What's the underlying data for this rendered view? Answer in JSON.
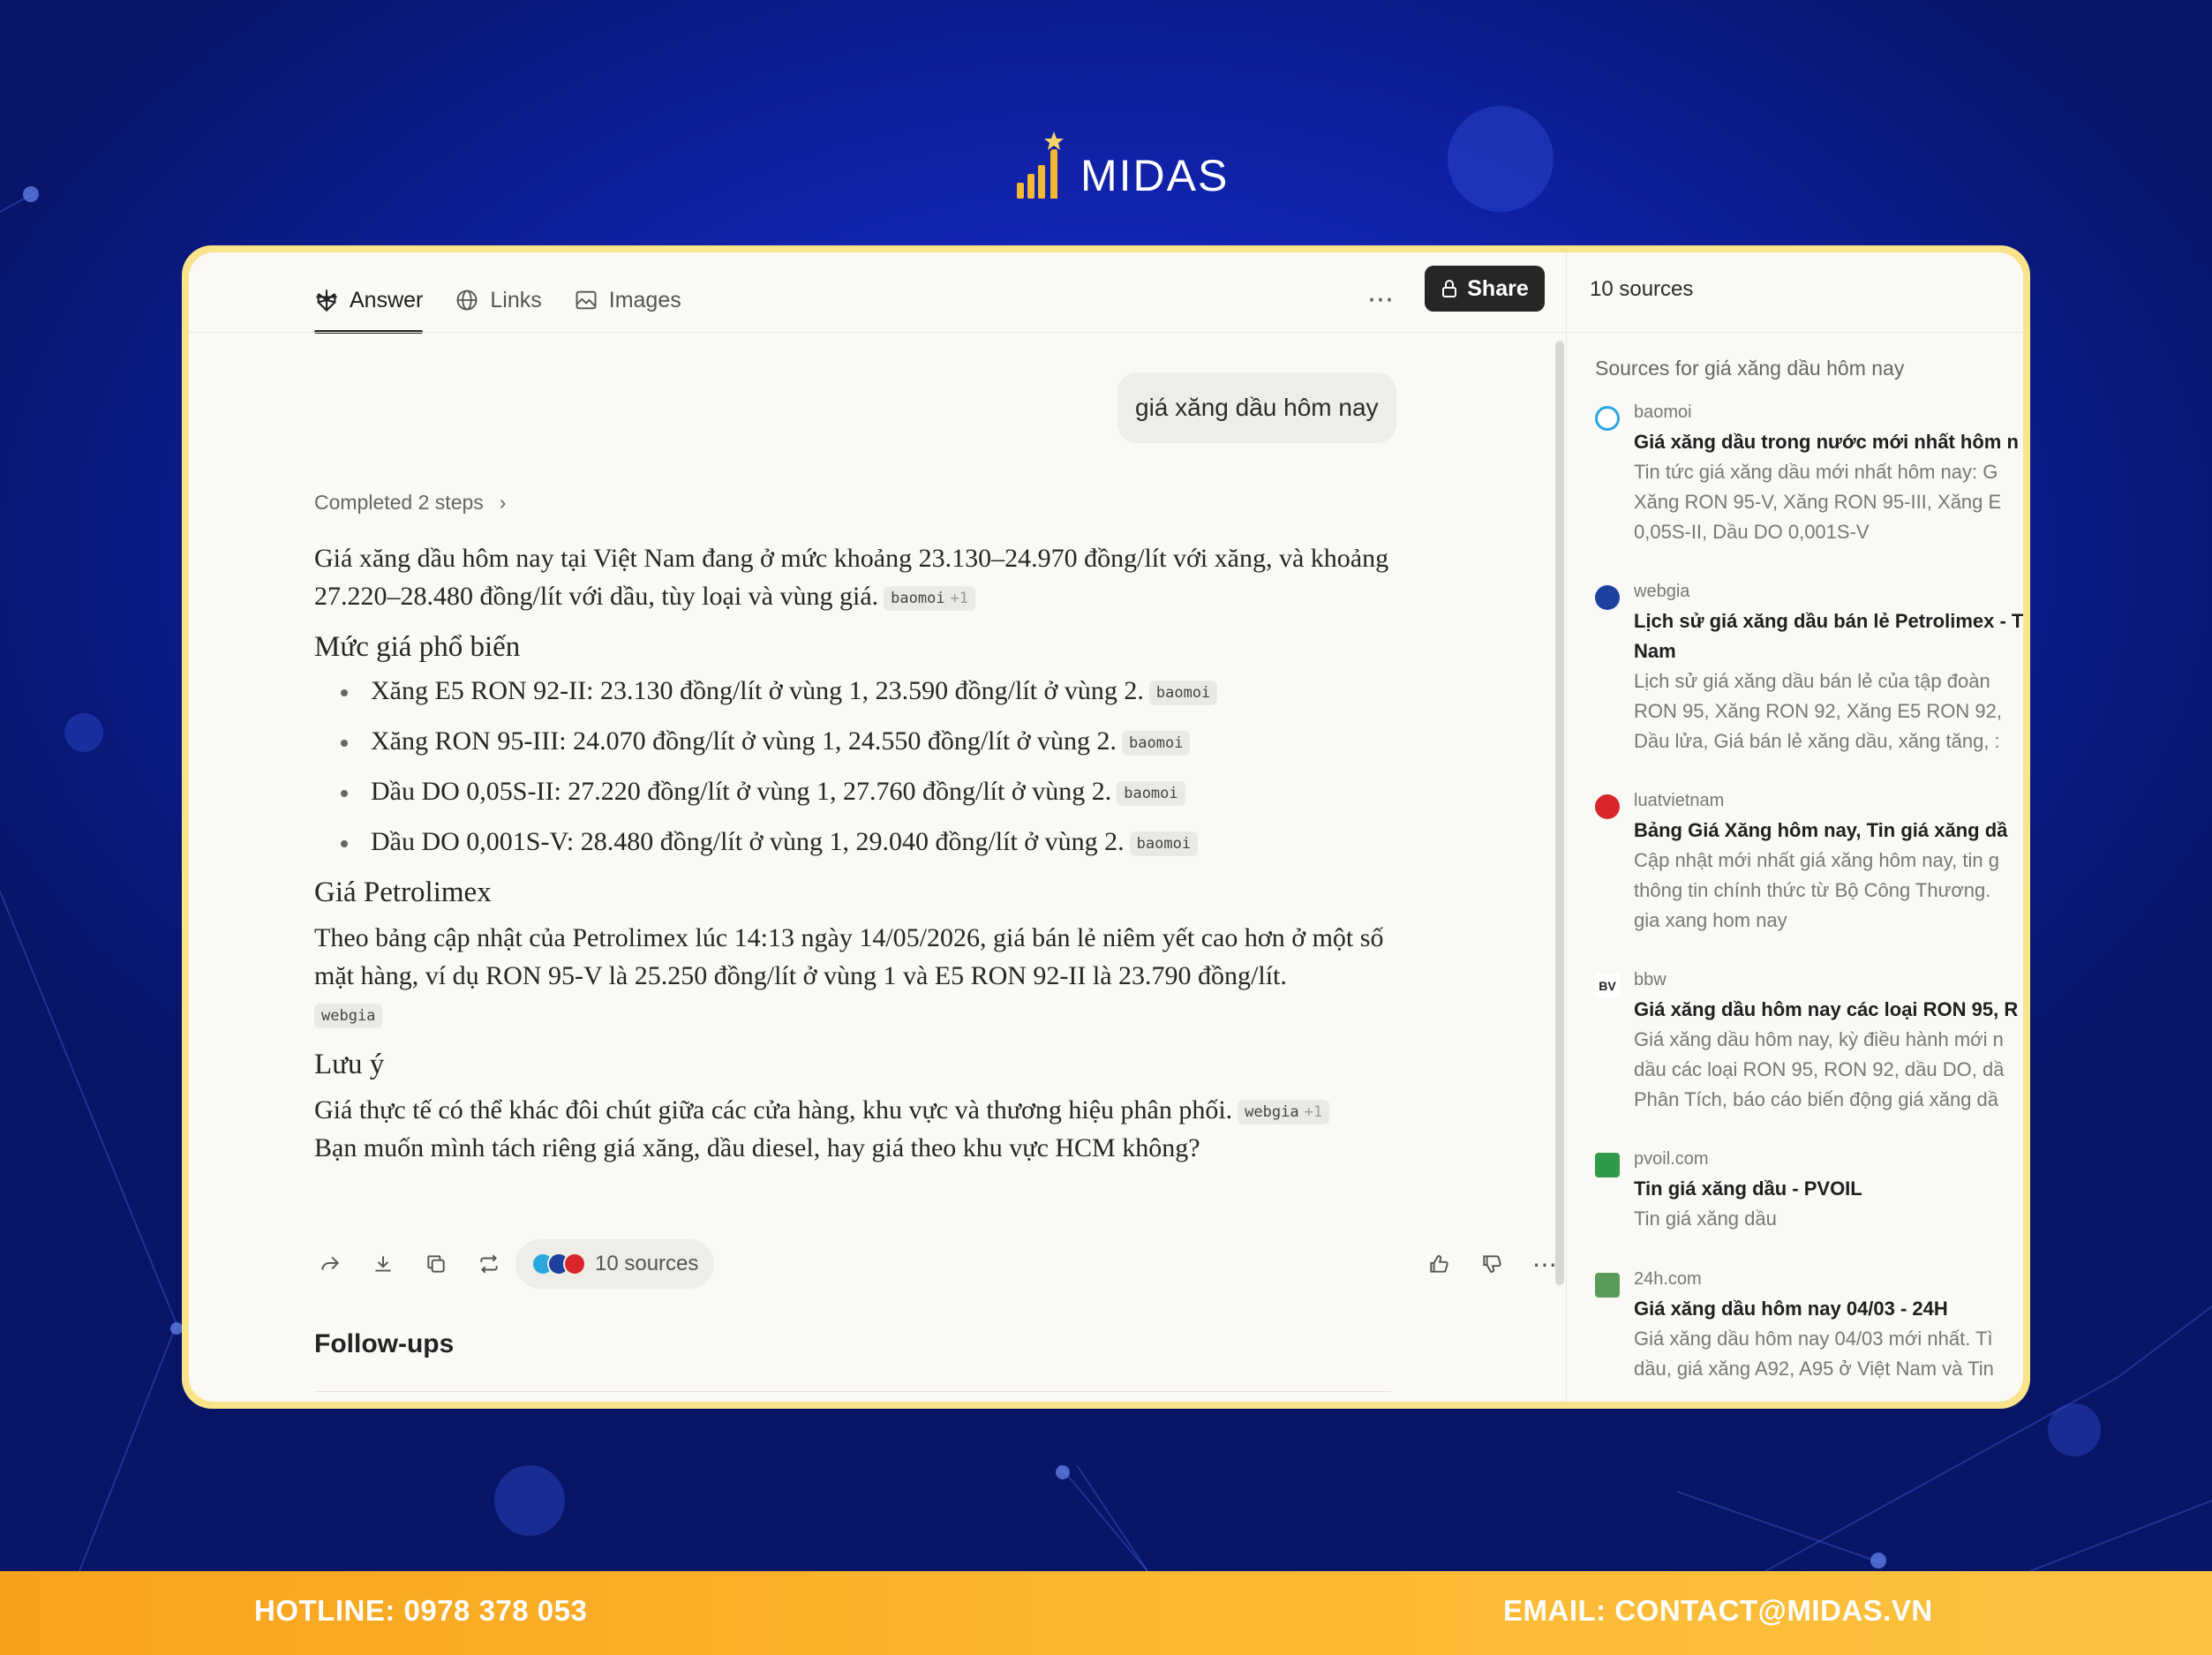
{
  "brand": {
    "name": "MIDAS"
  },
  "tabs": [
    {
      "label": "Answer",
      "icon": "perplexity-icon"
    },
    {
      "label": "Links",
      "icon": "globe-icon"
    },
    {
      "label": "Images",
      "icon": "image-icon"
    }
  ],
  "toolbar": {
    "more": "⋯",
    "share_label": "Share"
  },
  "query": "giá xăng dầu hôm nay",
  "steps": {
    "label": "Completed 2 steps",
    "chevron": "›"
  },
  "answer": {
    "intro": "Giá xăng dầu hôm nay tại Việt Nam đang ở mức khoảng 23.130–24.970 đồng/lít với xăng, và khoảng 27.220–28.480 đồng/lít với dầu, tùy loại và vùng giá.",
    "intro_cite": "baomoi",
    "intro_cite_plus": "+1",
    "h1": "Mức giá phổ biến",
    "items": [
      {
        "text": "Xăng E5 RON 92-II: 23.130 đồng/lít ở vùng 1, 23.590 đồng/lít ở vùng 2.",
        "cite": "baomoi"
      },
      {
        "text": "Xăng RON 95-III: 24.070 đồng/lít ở vùng 1, 24.550 đồng/lít ở vùng 2.",
        "cite": "baomoi"
      },
      {
        "text": "Dầu DO 0,05S-II: 27.220 đồng/lít ở vùng 1, 27.760 đồng/lít ở vùng 2.",
        "cite": "baomoi"
      },
      {
        "text": "Dầu DO 0,001S-V: 28.480 đồng/lít ở vùng 1, 29.040 đồng/lít ở vùng 2.",
        "cite": "baomoi"
      }
    ],
    "h2": "Giá Petrolimex",
    "p2": "Theo bảng cập nhật của Petrolimex lúc 14:13 ngày 14/05/2026, giá bán lẻ niêm yết cao hơn ở một số mặt hàng, ví dụ RON 95-V là 25.250 đồng/lít ở vùng 1 và E5 RON 92-II là 23.790 đồng/lít.",
    "p2_cite": "webgia",
    "h3": "Lưu ý",
    "p3": "Giá thực tế có thể khác đôi chút giữa các cửa hàng, khu vực và thương hiệu phân phối.",
    "p3_cite": "webgia",
    "p3_cite_plus": "+1",
    "p4": "Bạn muốn mình tách riêng giá xăng, dầu diesel, hay giá theo khu vực HCM không?"
  },
  "actions": {
    "sources_label": "10 sources",
    "more": "⋯"
  },
  "followups": "Follow-ups",
  "sidebar": {
    "header": "10 sources",
    "subtitle": "Sources for giá xăng dầu hôm nay",
    "sources": [
      {
        "domain": "baomoi",
        "title": "Giá xăng dầu trong nước mới nhất hôm n",
        "desc": [
          "Tin tức giá xăng dầu mới nhất hôm nay: G",
          "Xăng RON 95-V, Xăng RON 95-III, Xăng E",
          "0,05S-II, Dầu DO 0,001S-V"
        ],
        "color": "#2aa6e0"
      },
      {
        "domain": "webgia",
        "title": "Lịch sử giá xăng dầu bán lẻ Petrolimex - T",
        "title2": "Nam",
        "desc": [
          "Lịch sử giá xăng dầu bán lẻ của tập đoàn",
          "RON 95, Xăng RON 92, Xăng E5 RON 92,",
          "Dầu lửa, Giá bán lẻ xăng dầu, xăng tăng, :"
        ],
        "color": "#1d3f9e"
      },
      {
        "domain": "luatvietnam",
        "title": "Bảng Giá Xăng hôm nay, Tin giá xăng dầ",
        "desc": [
          "Cập nhật mới nhất giá xăng hôm nay, tin g",
          "thông tin chính thức từ Bộ Công Thương.",
          "gia xang hom nay"
        ],
        "color": "#d8262c"
      },
      {
        "domain": "bbw",
        "title": "Giá xăng dầu hôm nay các loại RON 95, R",
        "desc": [
          "Giá xăng dầu hôm nay, kỳ điều hành mới n",
          "dầu các loại RON 95, RON 92, dầu DO, dầ",
          "Phân Tích, báo cáo biến động giá xăng dầ"
        ],
        "color": "#222222"
      },
      {
        "domain": "pvoil.com",
        "title": "Tin giá xăng dầu - PVOIL",
        "desc": [
          "Tin giá xăng dầu"
        ],
        "color": "#2e9a4a"
      },
      {
        "domain": "24h.com",
        "title": "Giá xăng dầu hôm nay 04/03 - 24H",
        "desc": [
          "Giá xăng dầu hôm nay 04/03 mới nhất. Tì",
          "dầu, giá xăng A92, A95 ở Việt Nam và Tin"
        ],
        "color": "#5a9a5a"
      }
    ]
  },
  "footer": {
    "hotline": "HOTLINE: 0978 378 053",
    "email": "EMAIL: CONTACT@MIDAS.VN"
  }
}
